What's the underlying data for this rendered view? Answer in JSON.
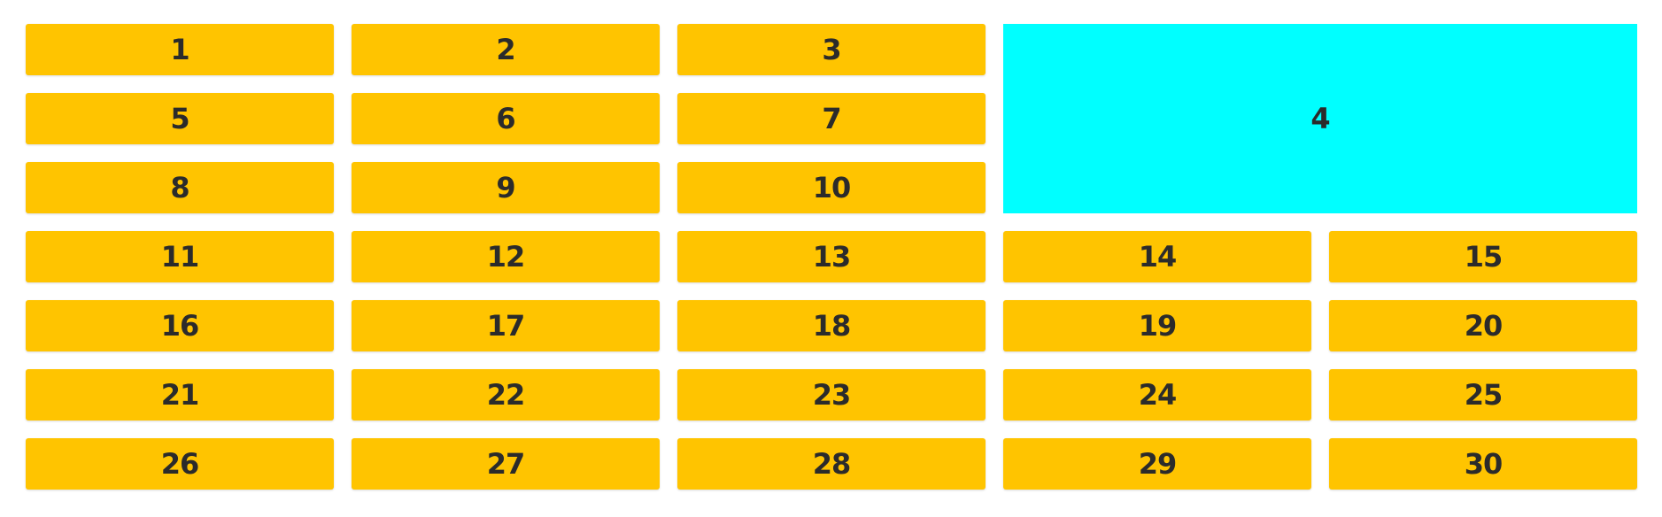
{
  "colors": {
    "cell": "#FFC400",
    "featured_cell": "#00FFFF",
    "text": "#2b2b2b"
  },
  "cells": [
    "1",
    "2",
    "3",
    "4",
    "5",
    "6",
    "7",
    "8",
    "9",
    "10",
    "11",
    "12",
    "13",
    "14",
    "15",
    "16",
    "17",
    "18",
    "19",
    "20",
    "21",
    "22",
    "23",
    "24",
    "25",
    "26",
    "27",
    "28",
    "29",
    "30"
  ]
}
